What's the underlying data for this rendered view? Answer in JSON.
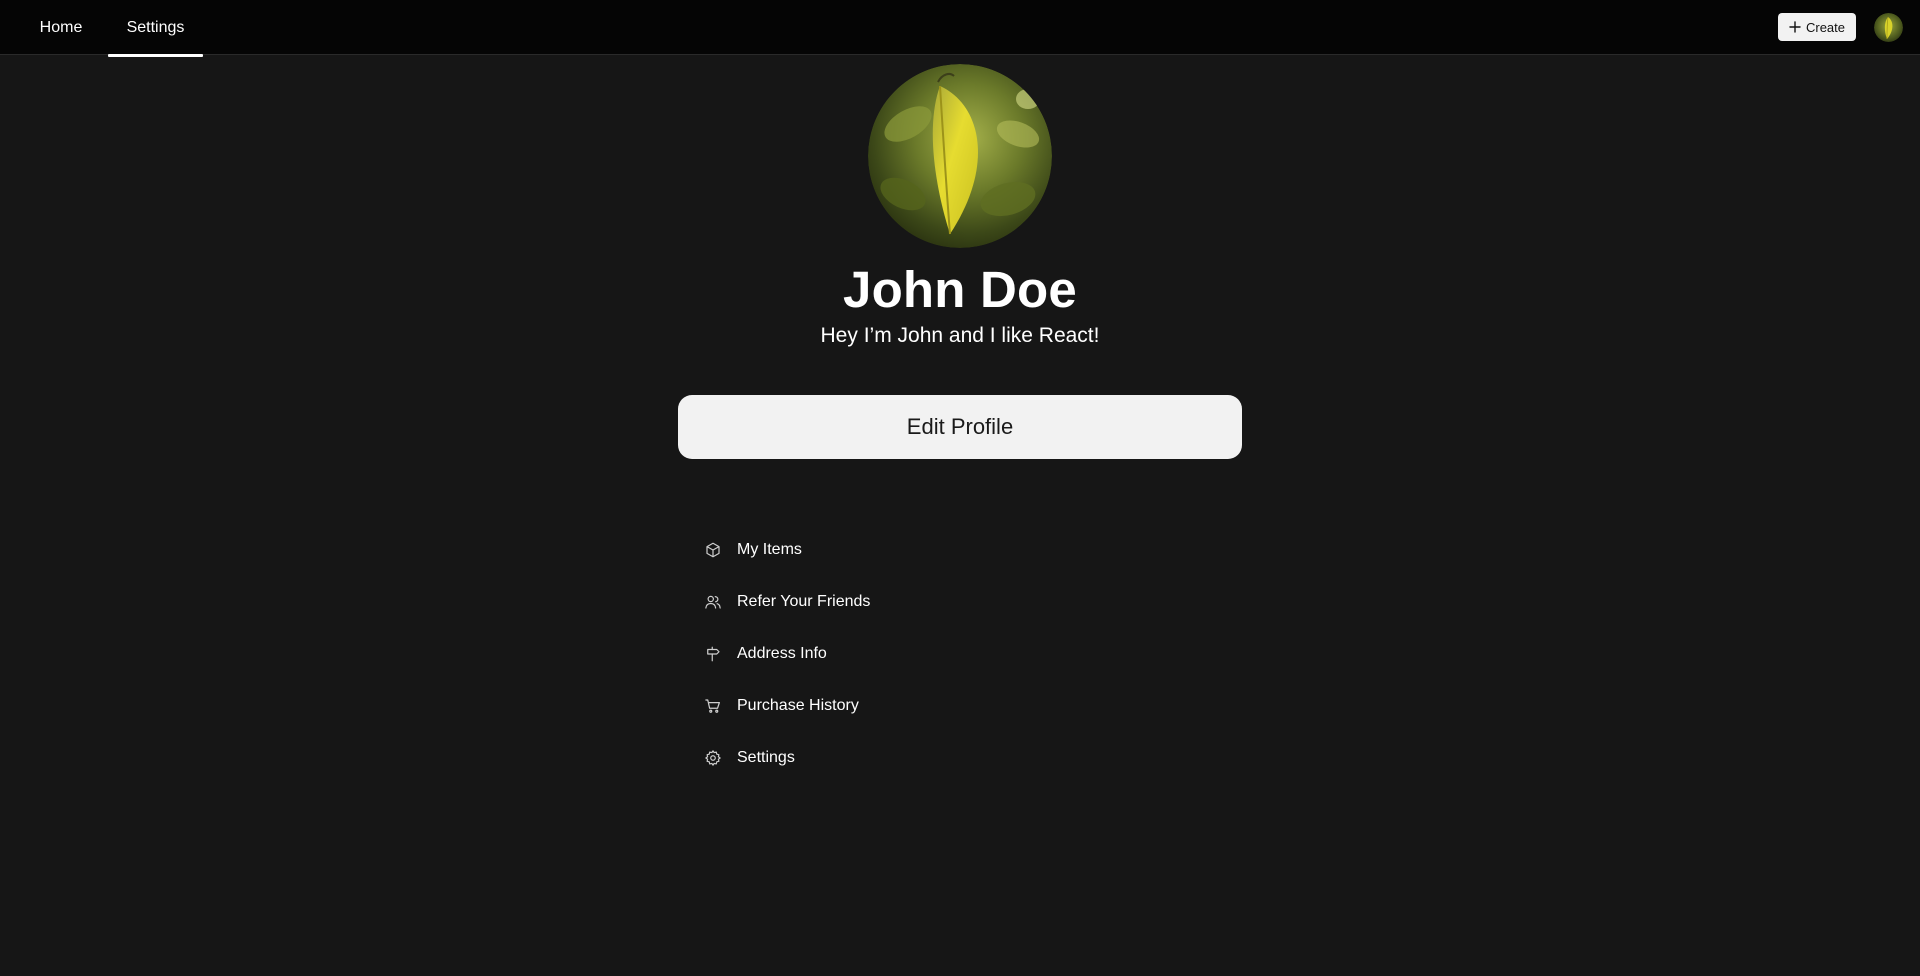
{
  "nav": {
    "tabs": [
      {
        "label": "Home",
        "active": false
      },
      {
        "label": "Settings",
        "active": true
      }
    ],
    "create_label": "Create",
    "create_icon": "plus-icon",
    "avatar_icon": "user-avatar"
  },
  "profile": {
    "name": "John Doe",
    "bio": "Hey I’m John and I like React!",
    "edit_label": "Edit Profile"
  },
  "menu": {
    "items": [
      {
        "label": "My Items",
        "icon": "box-icon"
      },
      {
        "label": "Refer Your Friends",
        "icon": "users-icon"
      },
      {
        "label": "Address Info",
        "icon": "signpost-icon"
      },
      {
        "label": "Purchase History",
        "icon": "cart-icon"
      },
      {
        "label": "Settings",
        "icon": "gear-icon"
      }
    ]
  },
  "colors": {
    "background": "#161616",
    "topbar": "#050505",
    "button_bg": "#f2f2f2",
    "text": "#ffffff"
  }
}
